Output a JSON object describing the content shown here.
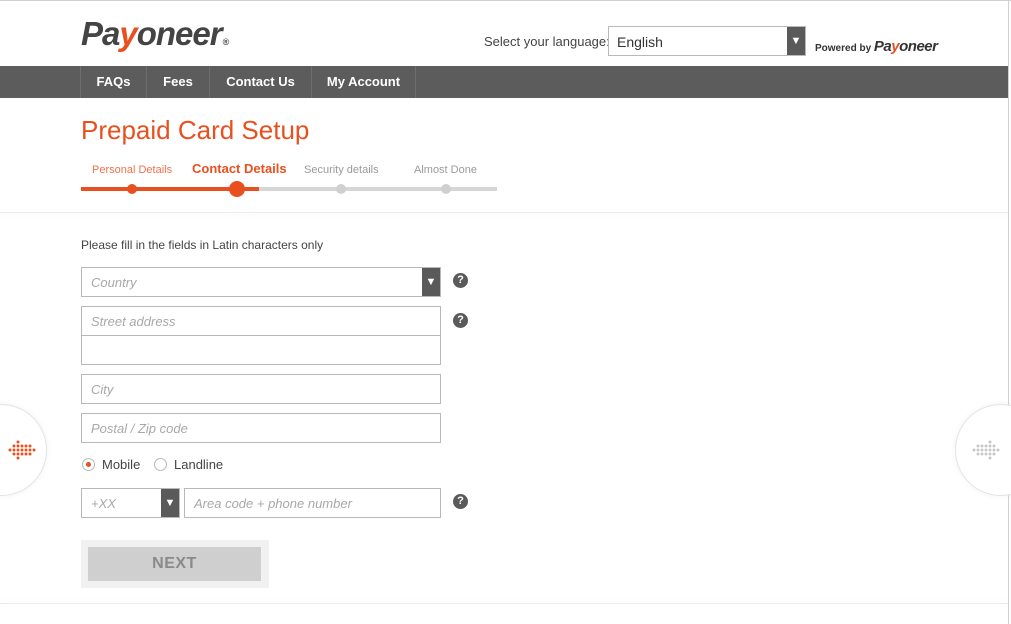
{
  "header": {
    "logo_text_before": "Pa",
    "logo_text_y": "y",
    "logo_text_after": "oneer",
    "logo_reg": "®",
    "language_label": "Select your language:",
    "language_value": "English",
    "powered_by": "Powered by",
    "powered_logo_before": "Pa",
    "powered_logo_y": "y",
    "powered_logo_after": "oneer"
  },
  "nav": {
    "items": [
      {
        "label": "FAQs"
      },
      {
        "label": "Fees"
      },
      {
        "label": "Contact Us"
      },
      {
        "label": "My Account"
      }
    ]
  },
  "page": {
    "title": "Prepaid Card Setup",
    "steps": [
      {
        "label": "Personal Details",
        "state": "done"
      },
      {
        "label": "Contact Details",
        "state": "active"
      },
      {
        "label": "Security details",
        "state": "pending"
      },
      {
        "label": "Almost Done",
        "state": "pending"
      }
    ]
  },
  "form": {
    "instruction": "Please fill in the fields in Latin characters only",
    "country_placeholder": "Country",
    "street_placeholder": "Street address",
    "city_placeholder": "City",
    "postal_placeholder": "Postal / Zip code",
    "phone_type_options": [
      {
        "label": "Mobile",
        "selected": true
      },
      {
        "label": "Landline",
        "selected": false
      }
    ],
    "country_code_placeholder": "+XX",
    "phone_placeholder": "Area code + phone number",
    "help_glyph": "?",
    "next_label": "NEXT"
  },
  "colors": {
    "accent": "#e8501f",
    "nav_bg": "#5c5c5c",
    "button_disabled": "#cfcfcf"
  },
  "icons": {
    "dropdown": "chevron-down-icon",
    "help": "question-circle-icon",
    "prev": "arrow-left-dotted-icon",
    "next": "arrow-right-dotted-icon"
  }
}
